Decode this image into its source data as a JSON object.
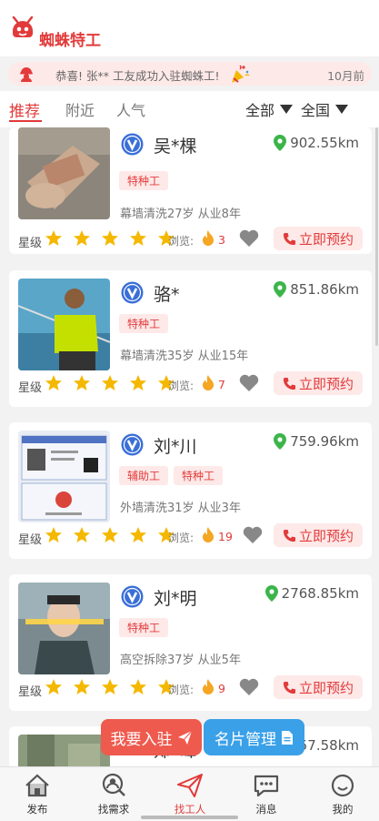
{
  "app": {
    "title": "蜘蛛特工"
  },
  "notice": {
    "text": "恭喜! 张** 工友成功入驻蜘蛛工!",
    "time": "10月前"
  },
  "tabs": [
    {
      "label": "推荐",
      "active": true
    },
    {
      "label": "附近",
      "active": false
    },
    {
      "label": "人气",
      "active": false
    }
  ],
  "filters": {
    "scope": "全部",
    "region": "全国"
  },
  "labels": {
    "star": "星级",
    "views": "浏览:",
    "book": "立即预约"
  },
  "workers": [
    {
      "name": "吴*棵",
      "distance": "902.55km",
      "tags": [
        "特种工"
      ],
      "desc": "幕墙清洗27岁 从业8年",
      "rating": 5,
      "views": "3"
    },
    {
      "name": "骆*",
      "distance": "851.86km",
      "tags": [
        "特种工"
      ],
      "desc": "幕墙清洗35岁 从业15年",
      "rating": 5,
      "views": "7"
    },
    {
      "name": "刘*川",
      "distance": "759.96km",
      "tags": [
        "辅助工",
        "特种工"
      ],
      "desc": "外墙清洗31岁 从业3年",
      "rating": 5,
      "views": "19"
    },
    {
      "name": "刘*明",
      "distance": "2768.85km",
      "tags": [
        "特种工"
      ],
      "desc": "高空拆除37岁 从业5年",
      "rating": 5,
      "views": "9"
    },
    {
      "name": "郑*峰",
      "distance": "757.58km"
    }
  ],
  "fab": {
    "join": "我要入驻",
    "cards": "名片管理"
  },
  "nav": [
    {
      "label": "发布",
      "icon": "home-icon"
    },
    {
      "label": "找需求",
      "icon": "search-person-icon"
    },
    {
      "label": "找工人",
      "icon": "paper-plane-icon",
      "active": true
    },
    {
      "label": "消息",
      "icon": "chat-icon"
    },
    {
      "label": "我的",
      "icon": "smile-icon"
    }
  ],
  "colors": {
    "accent": "#e23a3a",
    "blue": "#3aa0e8",
    "star": "#f5b800",
    "green": "#3bb54a"
  }
}
